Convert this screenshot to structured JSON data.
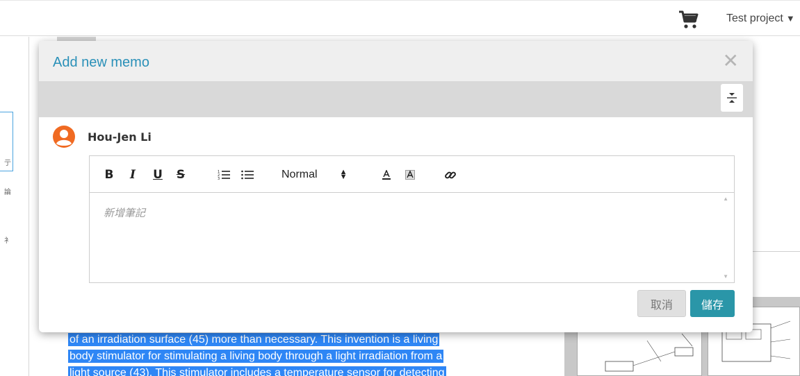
{
  "header": {
    "project_label": "Test project",
    "cart_icon": "cart-icon",
    "dropdown_icon": "caret-down-icon"
  },
  "background": {
    "rail_chars": [
      "亍",
      "論",
      "衤"
    ],
    "selected_text_lines": [
      "of an irradiation surface (45) more than necessary. This invention is a living",
      "body stimulator for stimulating a living body through a light irradiation from a",
      "light source (43). This stimulator includes a temperature sensor for detecting"
    ]
  },
  "modal": {
    "title": "Add new memo",
    "close_icon": "close-icon",
    "collapse_icon": "collapse-icon",
    "user": {
      "name": "Hou-Jen Li",
      "avatar_icon": "user-avatar-icon"
    },
    "editor": {
      "toolbar": {
        "bold": "B",
        "italic": "I",
        "underline": "U",
        "strike": "S",
        "font_size": "Normal"
      },
      "placeholder": "新增筆記"
    },
    "buttons": {
      "cancel": "取消",
      "save": "儲存"
    }
  },
  "colors": {
    "accent": "#2a90b8",
    "save_button": "#2a96a8",
    "selection": "#2e86f5"
  }
}
